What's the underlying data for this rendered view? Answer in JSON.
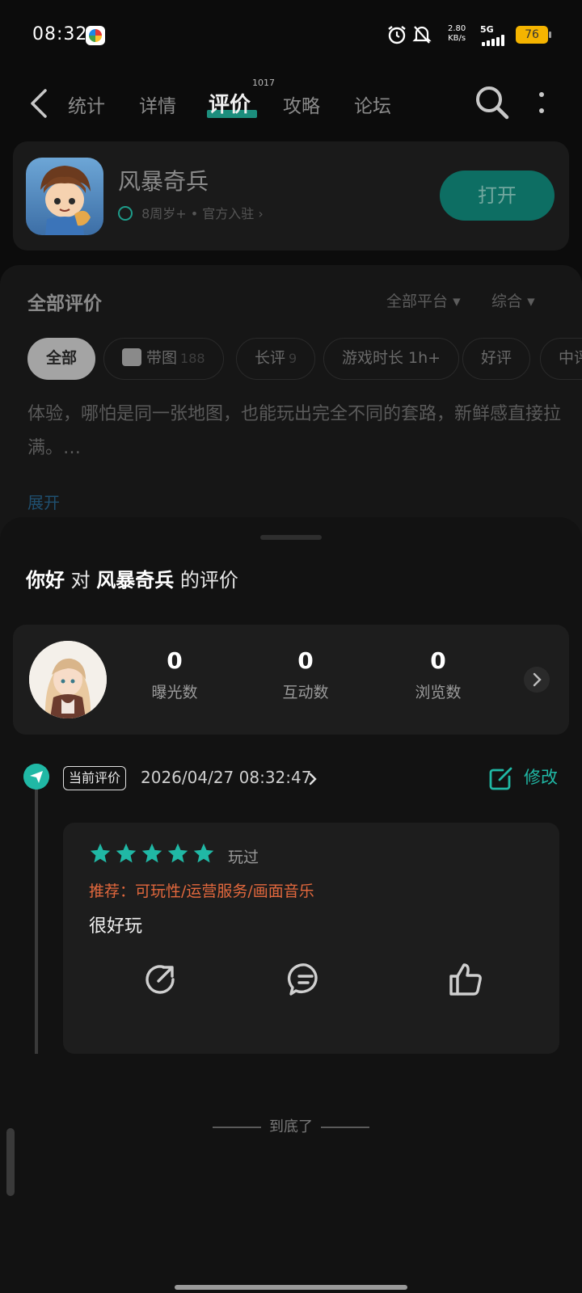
{
  "status_bar": {
    "time": "08:32",
    "speed_value": "2.80",
    "speed_unit": "KB/s",
    "network": "5G",
    "battery": "76"
  },
  "nav": {
    "tabs": [
      "统计",
      "详情",
      "评价",
      "攻略",
      "论坛"
    ],
    "active_tab": "评价",
    "review_count": "1017"
  },
  "game": {
    "name": "风暴奇兵",
    "meta": "8周岁+ • 官方入驻",
    "open_button": "打开"
  },
  "reviews_section": {
    "title": "全部评价",
    "platform_filter": "全部平台",
    "sort_filter": "综合",
    "chips": [
      {
        "label": "全部",
        "count": ""
      },
      {
        "label": "带图",
        "count": "188"
      },
      {
        "label": "长评",
        "count": "9"
      },
      {
        "label": "游戏时长 1h+",
        "count": ""
      },
      {
        "label": "好评",
        "count": ""
      },
      {
        "label": "中评",
        "count": ""
      }
    ],
    "snippet": "体验，哪怕是同一张地图，也能玩出完全不同的套路，新鲜感直接拉满。…",
    "expand": "展开"
  },
  "sheet": {
    "title_user": "你好",
    "title_mid": "对",
    "title_game": "风暴奇兵",
    "title_end": "的评价",
    "stats": [
      {
        "value": "0",
        "label": "曝光数"
      },
      {
        "value": "0",
        "label": "互动数"
      },
      {
        "value": "0",
        "label": "浏览数"
      }
    ],
    "current_tag": "当前评价",
    "date": "2026/04/27 08:32:47",
    "edit_label": "修改",
    "rating": 5,
    "played_label": "玩过",
    "recommend": "推荐：可玩性/运营服务/画面音乐",
    "review_text": "很好玩",
    "end_text": "到底了"
  },
  "colors": {
    "accent": "#20b8a5",
    "recommend": "#e2683d",
    "battery": "#f5b400"
  }
}
